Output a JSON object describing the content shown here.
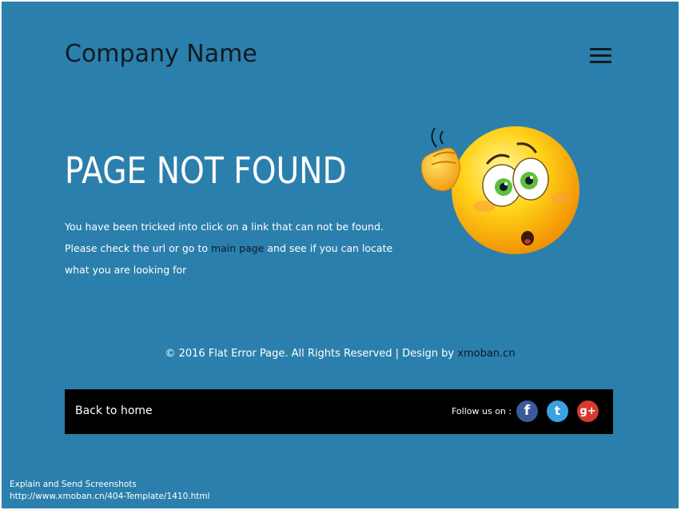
{
  "header": {
    "brand": "Company Name",
    "menu_icon": "hamburger-menu-icon"
  },
  "error": {
    "headline": "PAGE NOT FOUND",
    "message_before": "You have been tricked into click on a link that can not be found. Please check the url or go to ",
    "main_page_link": "main page",
    "message_after": " and see if you can locate what you are looking for",
    "illustration": "confused-emoji-icon"
  },
  "footer": {
    "copyright": "© 2016 Flat Error Page. All Rights Reserved | Design by ",
    "designer_link": "xmoban.cn",
    "back_home": "Back to home",
    "follow_label": "Follow us on :",
    "social": {
      "facebook": "f",
      "twitter": "t",
      "google_plus": "g+"
    }
  },
  "overlay": {
    "line1": "Explain and Send Screenshots",
    "line2": "http://www.xmoban.cn/404-Template/1410.html"
  },
  "colors": {
    "background": "#2b7fac",
    "bar": "#000000",
    "brand_text": "#111a22",
    "link": "#0b1a2b",
    "facebook": "#3b5a99",
    "twitter": "#3aa1e2",
    "google_plus": "#d43b30"
  }
}
